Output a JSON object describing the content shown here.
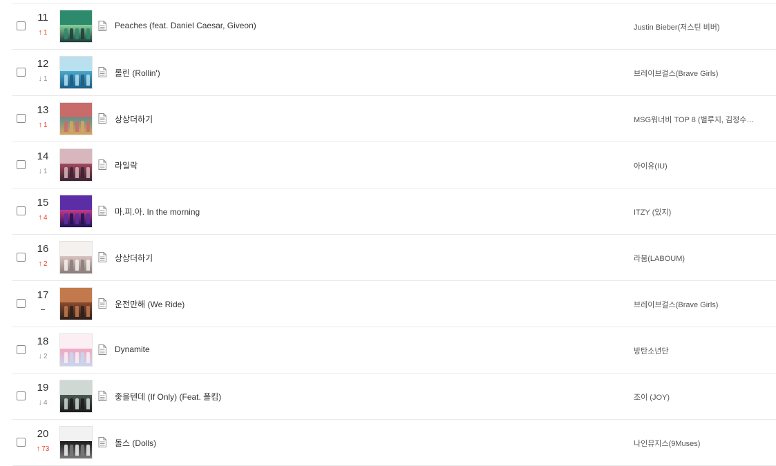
{
  "chart": {
    "rows": [
      {
        "rank": "11",
        "change": {
          "dir": "up",
          "value": "1"
        },
        "title": "Peaches (feat. Daniel Caesar, Giveon)",
        "artist": "Justin Bieber(저스틴 비버)",
        "cover_colors": [
          "#2e8a6d",
          "#8ad19a",
          "#1c3d3a"
        ]
      },
      {
        "rank": "12",
        "change": {
          "dir": "down",
          "value": "1"
        },
        "title": "롤린 (Rollin')",
        "artist": "브레이브걸스(Brave Girls)",
        "cover_colors": [
          "#b9e0ee",
          "#4aa7c9",
          "#1b5d86"
        ]
      },
      {
        "rank": "13",
        "change": {
          "dir": "up",
          "value": "1"
        },
        "title": "상상더하기",
        "artist": "MSG워너비 TOP 8 (별루지, 김정수…",
        "cover_colors": [
          "#c96b6b",
          "#5e8f8c",
          "#d9a45f"
        ]
      },
      {
        "rank": "14",
        "change": {
          "dir": "down",
          "value": "1"
        },
        "title": "라일락",
        "artist": "아이유(IU)",
        "cover_colors": [
          "#d8b6bd",
          "#a34a5f",
          "#3b2230"
        ]
      },
      {
        "rank": "15",
        "change": {
          "dir": "up",
          "value": "4"
        },
        "title": "마.피.아. In the morning",
        "artist": "ITZY (있지)",
        "cover_colors": [
          "#5b2ea7",
          "#c23a8a",
          "#1e1257"
        ]
      },
      {
        "rank": "16",
        "change": {
          "dir": "up",
          "value": "2"
        },
        "title": "상상더하기",
        "artist": "라붐(LABOUM)",
        "cover_colors": [
          "#f4f1ee",
          "#d9c3c0",
          "#8a7c7a"
        ]
      },
      {
        "rank": "17",
        "change": {
          "dir": "same",
          "value": ""
        },
        "title": "운전만해 (We Ride)",
        "artist": "브레이브걸스(Brave Girls)",
        "cover_colors": [
          "#c27a4d",
          "#8a4b2f",
          "#2b1e1a"
        ]
      },
      {
        "rank": "18",
        "change": {
          "dir": "down",
          "value": "2"
        },
        "title": "Dynamite",
        "artist": "방탄소년단",
        "cover_colors": [
          "#fbeff3",
          "#f0a7c0",
          "#c7d7f0"
        ]
      },
      {
        "rank": "19",
        "change": {
          "dir": "down",
          "value": "4"
        },
        "title": "좋을텐데 (If Only) (Feat. 폴킴)",
        "artist": "조이 (JOY)",
        "cover_colors": [
          "#cfd8d2",
          "#4e5a55",
          "#1b1b1b"
        ]
      },
      {
        "rank": "20",
        "change": {
          "dir": "up",
          "value": "73"
        },
        "title": "돌스 (Dolls)",
        "artist": "나인뮤지스(9Muses)",
        "cover_colors": [
          "#f2f2f2",
          "#1a1a1a",
          "#7a7a7a"
        ]
      }
    ]
  },
  "colors": {
    "up": "#e8412a",
    "down": "#8f8f8f",
    "divider": "#e9e9e9"
  },
  "icons": {
    "lyric": "document-icon",
    "up": "arrow-up-icon",
    "down": "arrow-down-icon",
    "same": "dash-icon"
  }
}
